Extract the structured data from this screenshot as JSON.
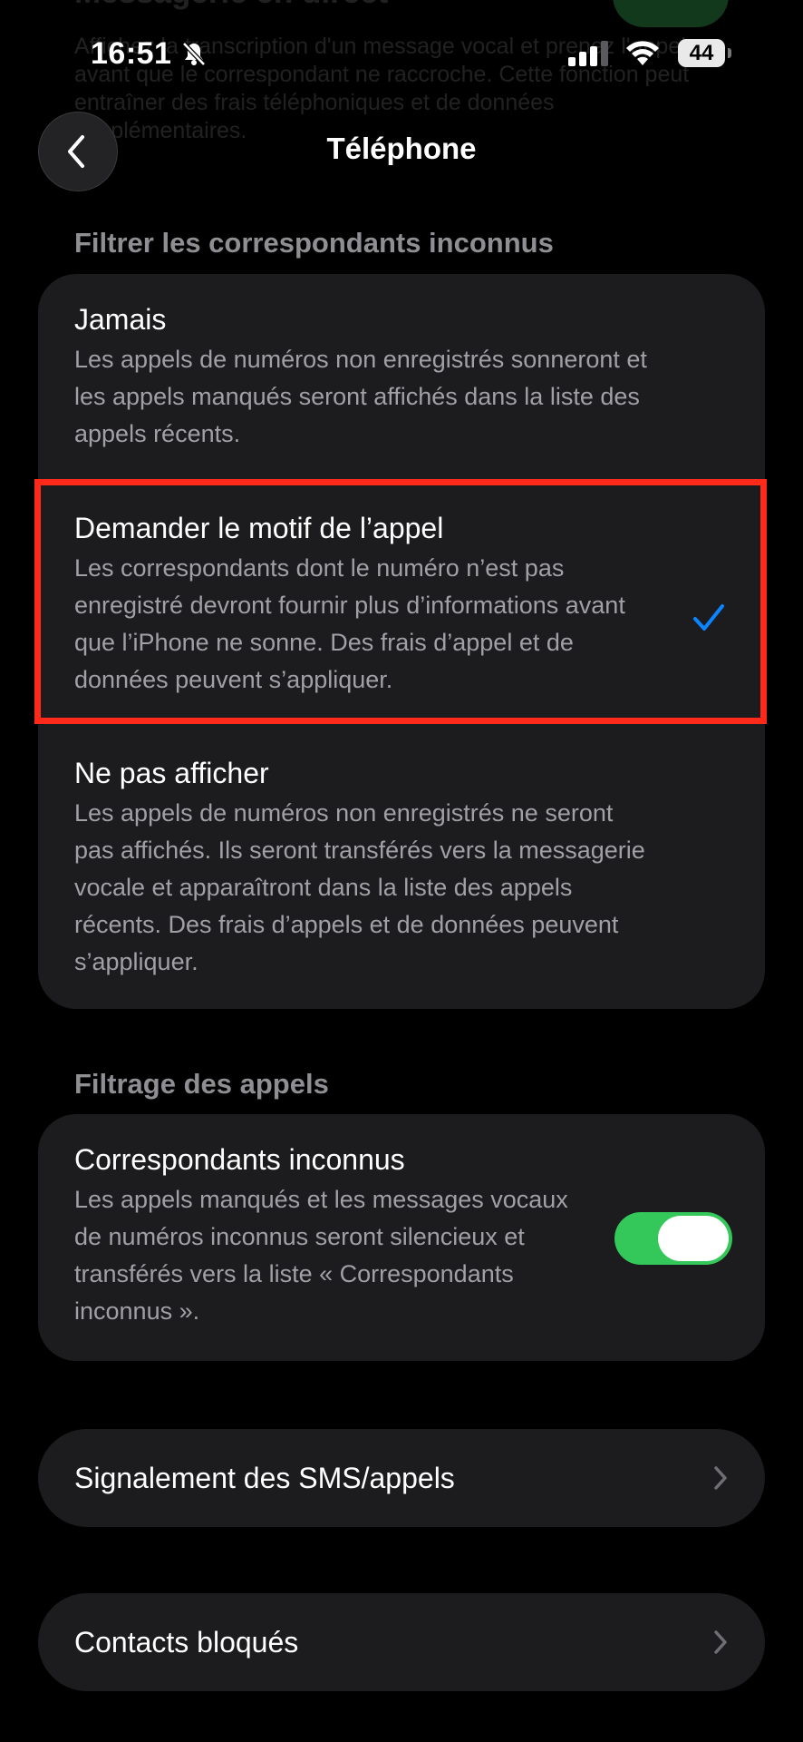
{
  "background_behind": {
    "title": "Messagerie en direct",
    "text": "Affichez la transcription d'un message vocal et prenez l'appel avant que le correspondant ne raccroche. Cette fonction peut entraîner des frais téléphoniques et de données supplémentaires."
  },
  "status_bar": {
    "time": "16:51",
    "battery": "44"
  },
  "nav": {
    "title": "Téléphone"
  },
  "filter_section": {
    "header": "Filtrer les correspondants inconnus",
    "options": [
      {
        "title": "Jamais",
        "description": "Les appels de numéros non enregistrés sonneront et les appels manqués seront affichés dans la liste des appels récents.",
        "selected": false
      },
      {
        "title": "Demander le motif de l’appel",
        "description": "Les correspondants dont le numéro n’est pas enregistré devront fournir plus d’informations avant que l’iPhone ne sonne. Des frais d’appel et de données peuvent s’appliquer.",
        "selected": true
      },
      {
        "title": "Ne pas afficher",
        "description": "Les appels de numéros non enregistrés ne seront pas affichés. Ils seront transférés vers la messagerie vocale et apparaîtront dans la liste des appels récents. Des frais d’appels et de données peuvent s’appliquer.",
        "selected": false
      }
    ]
  },
  "screening_section": {
    "header": "Filtrage des appels",
    "item": {
      "title": "Correspondants inconnus",
      "description": "Les appels manqués et les messages vocaux de numéros inconnus seront silencieux et transférés vers la liste « Correspondants inconnus ».",
      "enabled": true
    }
  },
  "rows": {
    "sms_reporting": "Signalement des SMS/appels",
    "blocked_contacts": "Contacts bloqués"
  },
  "colors": {
    "accent": "#0a84ff",
    "toggle_on": "#34c759",
    "highlight": "#ff2a1a",
    "card": "#1c1c1e",
    "secondary_text": "#a0a0a5",
    "section_header": "#8e8e93"
  },
  "icons": {
    "back": "chevron-left-icon",
    "bell": "bell-slash-icon",
    "signal": "cellular-signal-icon",
    "wifi": "wifi-icon",
    "check": "checkmark-icon",
    "chevron": "chevron-right-icon"
  }
}
